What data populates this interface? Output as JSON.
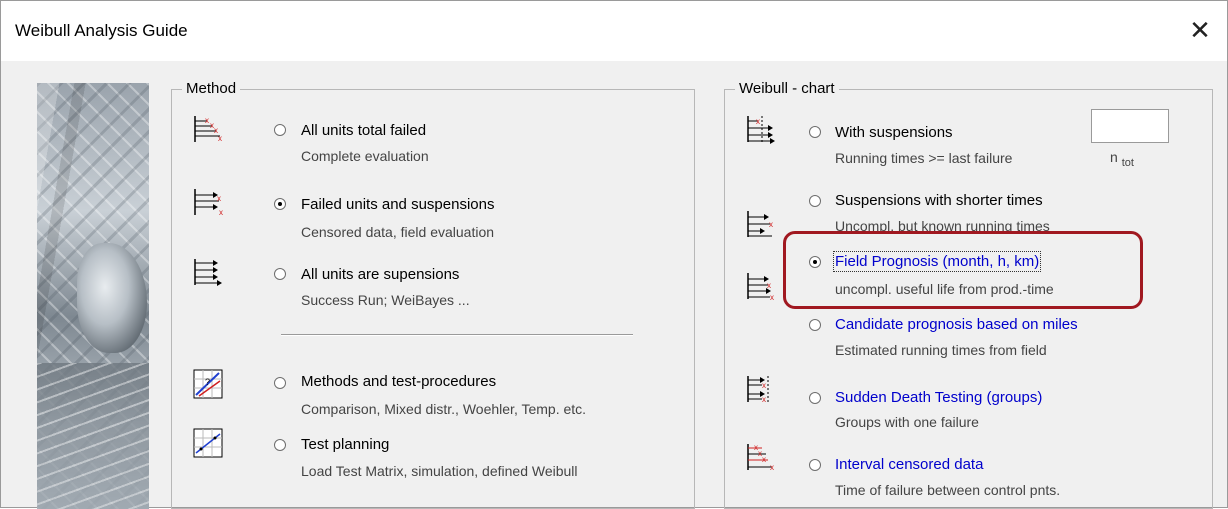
{
  "window": {
    "title": "Weibull Analysis Guide",
    "close_glyph": "✕"
  },
  "method": {
    "legend": "Method",
    "options": [
      {
        "label": "All units total failed",
        "sub": "Complete evaluation",
        "checked": false,
        "icon": "all-failed-icon"
      },
      {
        "label": "Failed units and suspensions",
        "sub": "Censored data, field evaluation",
        "checked": true,
        "icon": "failed-and-suspensions-icon"
      },
      {
        "label": "All units are supensions",
        "sub": "Success Run;  WeiBayes ...",
        "checked": false,
        "icon": "all-suspensions-icon"
      },
      {
        "label": "Methods and test-procedures",
        "sub": "Comparison, Mixed distr., Woehler, Temp. etc.",
        "checked": false,
        "icon": "methods-chart-icon"
      },
      {
        "label": "Test planning",
        "sub": "Load Test Matrix, simulation, defined Weibull",
        "checked": false,
        "icon": "test-planning-icon"
      }
    ]
  },
  "chart": {
    "legend": "Weibull - chart",
    "ntot_label": "n",
    "ntot_sub": "tot",
    "ntot_value": "",
    "options": [
      {
        "label": "With suspensions",
        "sub": "Running times >= last failure",
        "checked": false
      },
      {
        "label": "Suspensions with shorter times",
        "sub": "Uncompl. but known running times",
        "checked": false
      },
      {
        "label": "Field Prognosis (month, h, km)",
        "sub": "uncompl. useful life from prod.-time",
        "checked": true
      },
      {
        "label": "Candidate prognosis based on miles",
        "sub": "Estimated running times from field",
        "checked": false
      },
      {
        "label": "Sudden Death Testing (groups)",
        "sub": "Groups with one failure",
        "checked": false
      },
      {
        "label": "Interval censored data",
        "sub": "Time of failure between control pnts.",
        "checked": false
      }
    ]
  },
  "colors": {
    "accent_blue": "#0000cc",
    "highlight_red": "#a01820",
    "failure_red": "#d02020"
  }
}
